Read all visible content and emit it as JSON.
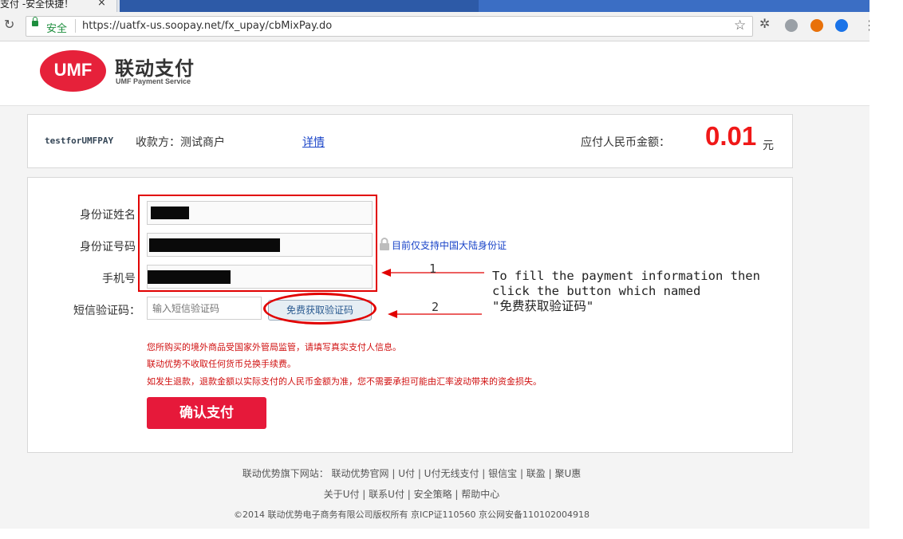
{
  "browser": {
    "tab_title": "支付 -安全快捷！",
    "tab_close": "×",
    "secure_label": "安全",
    "url": "https://uatfx-us.soopay.net/fx_upay/cbMixPay.do",
    "reload_icon": "↻",
    "star_icon": "☆",
    "menu_icon": "⋮"
  },
  "brand": {
    "logo_text": "UMF",
    "name_cn": "联动支付",
    "name_en": "UMF Payment Service",
    "accent": "#e6213a"
  },
  "order": {
    "merchant_id": "testforUMFPAY",
    "payee_label": "收款方：测试商户",
    "details_link": "详情",
    "amount_label": "应付人民币金额：",
    "amount": "0.01",
    "currency": "元",
    "amount_color": "#f01818"
  },
  "form": {
    "name_label": "身份证姓名",
    "id_label": "身份证号码",
    "id_note": "目前仅支持中国大陆身份证",
    "phone_label": "手机号",
    "sms_label": "短信验证码：",
    "sms_placeholder": "输入短信验证码",
    "sms_button": "免费获取验证码",
    "notices": [
      "您所购买的境外商品受国家外管局监管，请填写真实支付人信息。",
      "联动优势不收取任何货币兑换手续费。",
      "如发生退款，退款金额以实际支付的人民币金额为准，您不需要承担可能由汇率波动带来的资金损失。"
    ],
    "confirm_button": "确认支付"
  },
  "annotation": {
    "step1": "1",
    "step2": "2",
    "text": "To fill the payment information then\nclick the button which named\n\"免费获取验证码\"",
    "color": "#e10000"
  },
  "footer": {
    "line1": "联动优势旗下网站： 联动优势官网 | U付 | U付无线支付 | 银信宝 | 联盈 | 聚U惠",
    "line2": "关于U付 | 联系U付 | 安全策略 | 帮助中心",
    "line3": "©2014 联动优势电子商务有限公司版权所有   京ICP证110560   京公网安备110102004918"
  }
}
